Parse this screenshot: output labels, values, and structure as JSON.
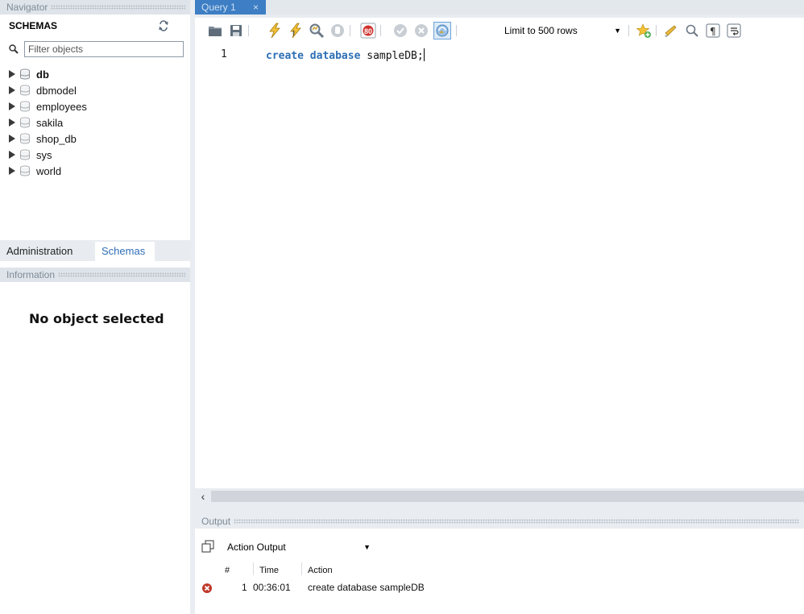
{
  "navigator": {
    "title": "Navigator",
    "schemas_heading": "SCHEMAS",
    "filter_placeholder": "Filter objects",
    "schemas": [
      {
        "name": "db",
        "bold": true
      },
      {
        "name": "dbmodel"
      },
      {
        "name": "employees"
      },
      {
        "name": "sakila"
      },
      {
        "name": "shop_db"
      },
      {
        "name": "sys"
      },
      {
        "name": "world"
      }
    ],
    "tabs": {
      "administration": "Administration",
      "schemas": "Schemas"
    },
    "information_title": "Information",
    "no_object": "No object selected"
  },
  "editor": {
    "tab_label": "Query 1",
    "tab_close": "×",
    "limit_label": "Limit to 500 rows",
    "line_number": "1",
    "code": {
      "kw1": "create",
      "kw2": "database",
      "ident": "sampleDB;"
    }
  },
  "output": {
    "title": "Output",
    "selector": "Action Output",
    "columns": {
      "num": "#",
      "time": "Time",
      "action": "Action"
    },
    "rows": [
      {
        "num": "1",
        "time": "00:36:01",
        "action": "create database sampleDB",
        "status": "error"
      }
    ]
  },
  "colors": {
    "accent": "#3d7ec4",
    "keyword": "#2d6fb5",
    "error": "#c0392b",
    "tab_active_text": "#2f6eb7"
  }
}
